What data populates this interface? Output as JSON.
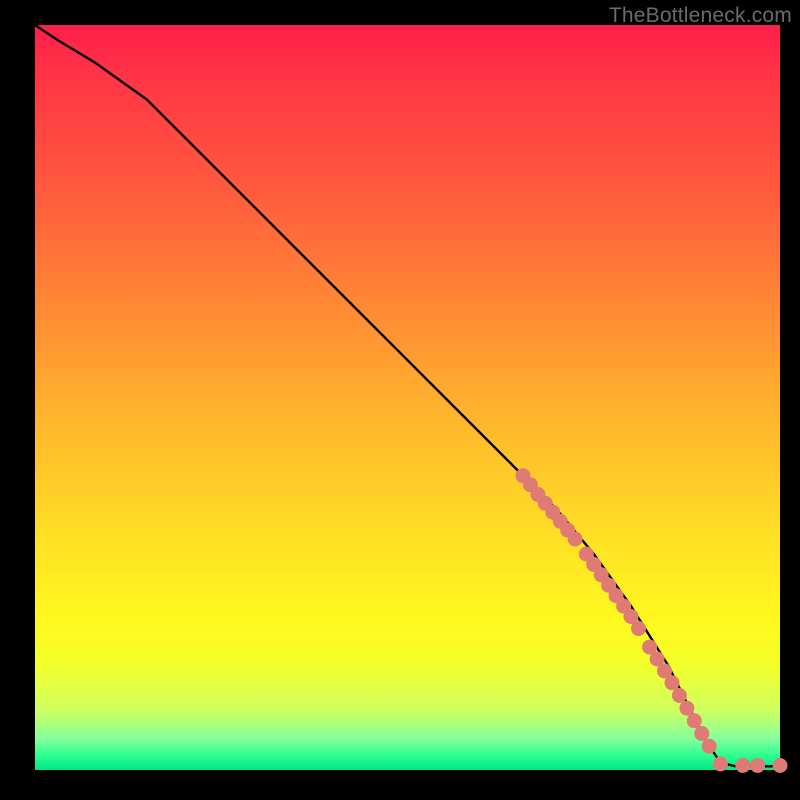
{
  "watermark": "TheBottleneck.com",
  "colors": {
    "gradient_top": "#ff1e4b",
    "gradient_mid": "#ffe324",
    "gradient_bottom": "#00e68a",
    "line": "#000000",
    "marker": "#e07a74",
    "background": "#000000"
  },
  "chart_data": {
    "type": "line",
    "title": "",
    "xlabel": "",
    "ylabel": "",
    "xlim": [
      0,
      100
    ],
    "ylim": [
      0,
      100
    ],
    "grid": false,
    "legend": false,
    "series": [
      {
        "name": "curve",
        "x": [
          0,
          3,
          8,
          15,
          25,
          35,
          45,
          55,
          65,
          70,
          75,
          80,
          85,
          88,
          90,
          92,
          94,
          96,
          98,
          100
        ],
        "y": [
          100,
          98,
          95,
          90,
          80,
          70,
          60,
          50,
          40,
          35,
          29,
          22,
          14,
          8,
          4,
          1,
          0.5,
          0.5,
          0.5,
          0.5
        ]
      }
    ],
    "markers": [
      {
        "x": 65.5,
        "y": 39.5
      },
      {
        "x": 66.5,
        "y": 38.3
      },
      {
        "x": 67.5,
        "y": 37.0
      },
      {
        "x": 68.5,
        "y": 35.8
      },
      {
        "x": 69.5,
        "y": 34.6
      },
      {
        "x": 70.5,
        "y": 33.4
      },
      {
        "x": 71.5,
        "y": 32.2
      },
      {
        "x": 72.5,
        "y": 31.0
      },
      {
        "x": 74.0,
        "y": 29.0
      },
      {
        "x": 75.0,
        "y": 27.6
      },
      {
        "x": 76.0,
        "y": 26.2
      },
      {
        "x": 77.0,
        "y": 24.8
      },
      {
        "x": 78.0,
        "y": 23.4
      },
      {
        "x": 79.0,
        "y": 22.0
      },
      {
        "x": 80.0,
        "y": 20.6
      },
      {
        "x": 81.0,
        "y": 19.0
      },
      {
        "x": 82.5,
        "y": 16.5
      },
      {
        "x": 83.5,
        "y": 14.9
      },
      {
        "x": 84.5,
        "y": 13.3
      },
      {
        "x": 85.5,
        "y": 11.7
      },
      {
        "x": 86.5,
        "y": 10.0
      },
      {
        "x": 87.5,
        "y": 8.3
      },
      {
        "x": 88.5,
        "y": 6.6
      },
      {
        "x": 89.5,
        "y": 4.9
      },
      {
        "x": 90.5,
        "y": 3.2
      },
      {
        "x": 92.0,
        "y": 0.8
      },
      {
        "x": 95.0,
        "y": 0.6
      },
      {
        "x": 97.0,
        "y": 0.6
      },
      {
        "x": 100.0,
        "y": 0.6
      }
    ]
  }
}
